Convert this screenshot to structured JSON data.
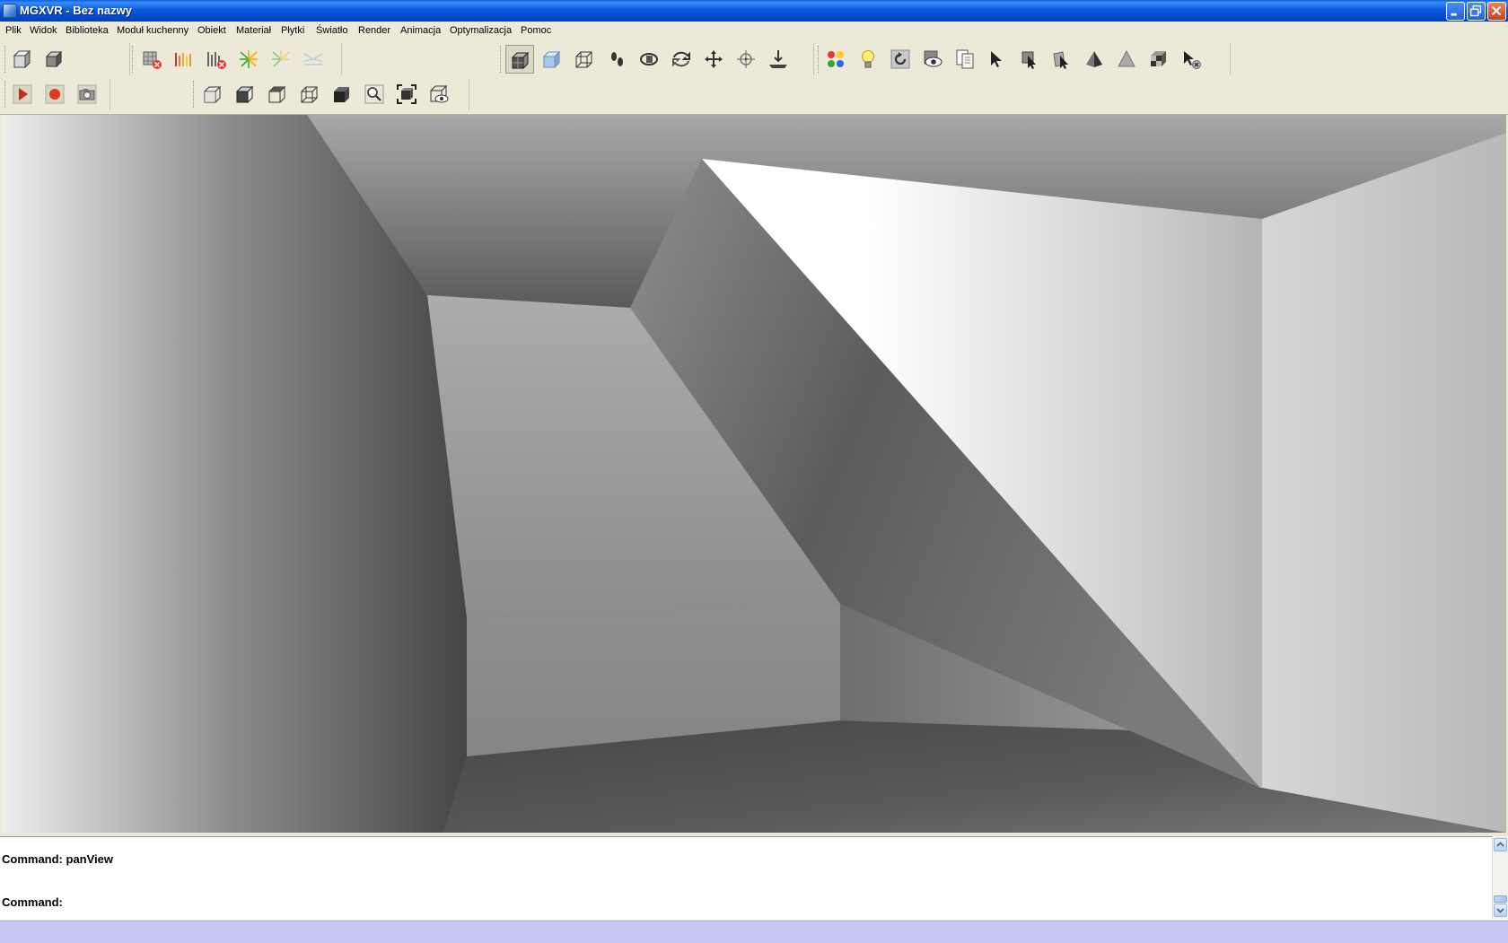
{
  "window": {
    "title": "MGXVR - Bez nazwy"
  },
  "menu": {
    "items": [
      "Plik",
      "Widok",
      "Biblioteka",
      "Moduł kuchenny",
      "Obiekt",
      "Materiał",
      "Płytki",
      "Światło",
      "Render",
      "Animacja",
      "Optymalizacja",
      "Pomoc"
    ]
  },
  "toolbar": {
    "file_tools": [
      "new-object-icon",
      "copy-object-icon"
    ],
    "effects_tools": [
      "delete-texture-icon",
      "color-bars-icon",
      "delete-bars-icon",
      "light-rays-icon",
      "light-rays-alt-icon",
      "fade-rays-icon"
    ],
    "view_tools": [
      "shaded-cube-icon",
      "blue-cube-icon",
      "wireframe-cube-icon",
      "walk-icon",
      "orbit-icon",
      "rotate-icon",
      "pan-icon",
      "target-icon",
      "ground-icon"
    ],
    "object_tools": [
      "color-balls-icon",
      "lightbulb-icon",
      "refresh-icon",
      "eye-icon",
      "document-icon",
      "select-arrow-icon",
      "select-box-icon",
      "select-face-icon",
      "pyramid-icon",
      "triangle-icon",
      "checker-cube-icon",
      "select-delete-icon"
    ],
    "animation_tools": [
      "play-icon",
      "record-icon",
      "camera-icon"
    ],
    "projection_tools": [
      "front-view-icon",
      "side-view-icon",
      "top-view-icon",
      "iso-view-icon",
      "dark-cube-icon",
      "zoom-icon",
      "zoom-extents-icon",
      "perspective-icon"
    ],
    "pressed_tool": "shaded-cube-icon"
  },
  "console": {
    "lines": [
      "Command: panView",
      "Command:"
    ]
  },
  "colors": {
    "titlebar": "#0a5fdf",
    "statusbar": "#c5c8f2",
    "record": "#e03a1a"
  }
}
